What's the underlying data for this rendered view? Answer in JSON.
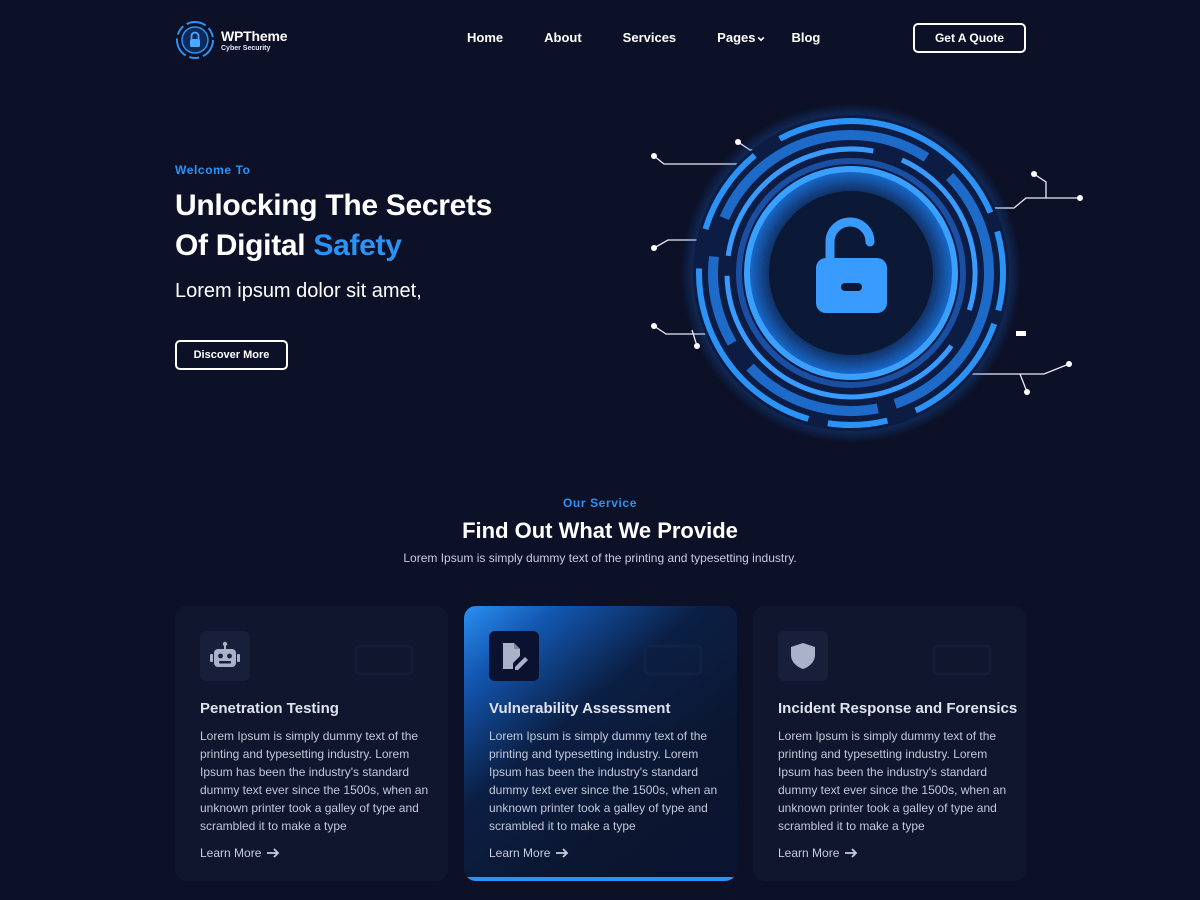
{
  "brand": {
    "name": "WPTheme",
    "tagline": "Cyber Security"
  },
  "nav": {
    "items": [
      {
        "label": "Home"
      },
      {
        "label": "About"
      },
      {
        "label": "Services"
      },
      {
        "label": "Pages",
        "has_dropdown": true
      },
      {
        "label": "Blog"
      }
    ]
  },
  "header": {
    "cta_label": "Get A Quote"
  },
  "hero": {
    "eyebrow": "Welcome To",
    "title_line1": "Unlocking The Secrets",
    "title_line2_prefix": "Of Digital ",
    "title_line2_accent": "Safety",
    "subtitle": "Lorem ipsum dolor sit amet,",
    "button_label": "Discover More",
    "illustration_icon": "unlocked-padlock-icon"
  },
  "services": {
    "eyebrow": "Our Service",
    "title": "Find Out What We Provide",
    "description": "Lorem Ipsum is simply dummy text of the printing and typesetting industry.",
    "cards": [
      {
        "icon": "robot-icon",
        "title": "Penetration Testing",
        "text": "Lorem Ipsum is simply dummy text of the printing and typesetting industry. Lorem Ipsum has been the industry's standard dummy text ever since the 1500s, when an unknown printer took a galley of type and scrambled it to make a type",
        "link_label": "Learn More",
        "active": false
      },
      {
        "icon": "document-edit-icon",
        "title": "Vulnerability Assessment",
        "text": "Lorem Ipsum is simply dummy text of the printing and typesetting industry. Lorem Ipsum has been the industry's standard dummy text ever since the 1500s, when an unknown printer took a galley of type and scrambled it to make a type",
        "link_label": "Learn More",
        "active": true
      },
      {
        "icon": "shield-icon",
        "title": "Incident Response and Forensics",
        "text": "Lorem Ipsum is simply dummy text of the printing and typesetting industry. Lorem Ipsum has been the industry's standard dummy text ever since the 1500s, when an unknown printer took a galley of type and scrambled it to make a type",
        "link_label": "Learn More",
        "active": false
      }
    ]
  },
  "colors": {
    "background": "#0c1128",
    "accent": "#2b93f5",
    "card": "#0f162d"
  }
}
